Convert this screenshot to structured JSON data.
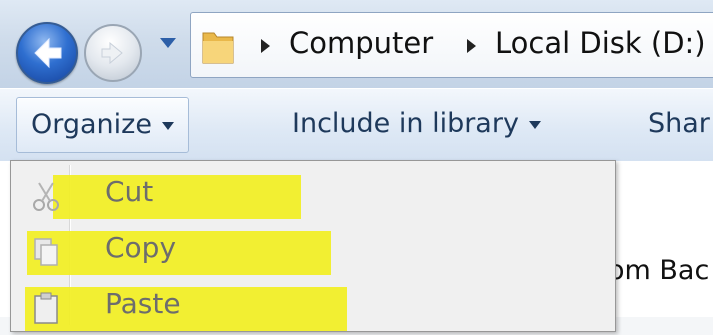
{
  "navigation": {
    "back_icon": "back-arrow-icon",
    "forward_icon": "forward-arrow-icon",
    "recent_icon": "chevron-down-icon"
  },
  "address_bar": {
    "breadcrumbs": [
      {
        "label": "Computer"
      },
      {
        "label": "Local Disk (D:)"
      }
    ]
  },
  "command_bar": {
    "organize_label": "Organize",
    "include_label": "Include in library",
    "share_label": "Shar"
  },
  "organize_menu": {
    "items": [
      {
        "label": "Cut",
        "icon": "scissors-icon"
      },
      {
        "label": "Copy",
        "icon": "copy-icon"
      },
      {
        "label": "Paste",
        "icon": "clipboard-icon"
      }
    ],
    "highlight_color": "#f2ef22"
  },
  "file_list": {
    "partial_item_label": "om Bac"
  },
  "colors": {
    "command_text": "#1e395b",
    "menu_text_disabled": "#6d6d6d"
  }
}
